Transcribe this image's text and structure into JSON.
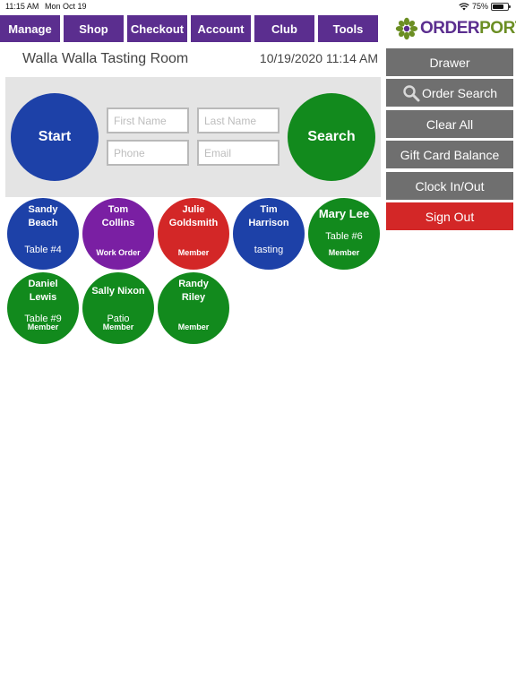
{
  "status_bar": {
    "time": "11:15 AM",
    "date": "Mon Oct 19",
    "battery": "75%",
    "battery_level": 0.75
  },
  "nav": {
    "items": [
      "Manage",
      "Shop",
      "Checkout",
      "Account",
      "Club",
      "Tools"
    ]
  },
  "logo": {
    "text_part1": "ORDER",
    "text_part2": "PORT",
    "icon": "flower-logo-icon",
    "color_1": "#5b2e8f",
    "color_2": "#6b8e23"
  },
  "header": {
    "room": "Walla Walla Tasting Room",
    "datetime": "10/19/2020 11:14 AM"
  },
  "search_panel": {
    "start_label": "Start",
    "search_label": "Search",
    "first_name_placeholder": "First Name",
    "last_name_placeholder": "Last Name",
    "phone_placeholder": "Phone",
    "email_placeholder": "Email"
  },
  "sidebar": {
    "drawer": "Drawer",
    "order_search": "Order Search",
    "clear_all": "Clear All",
    "gift_card_balance": "Gift Card Balance",
    "clock_in_out": "Clock In/Out",
    "sign_out": "Sign Out"
  },
  "orders": [
    {
      "name": "Sandy\nBeach",
      "sub": "Table #4",
      "tag": "",
      "color": "#1d41a8"
    },
    {
      "name": "Tom\nCollins",
      "sub": "",
      "tag": "Work Order",
      "color": "#7a1fa3"
    },
    {
      "name": "Julie\nGoldsmith",
      "sub": "",
      "tag": "Member",
      "color": "#d32727"
    },
    {
      "name": "Tim\nHarrison",
      "sub": "tasting",
      "tag": "",
      "color": "#1d41a8"
    },
    {
      "name": "Mary Lee",
      "sub": "Table #6",
      "tag": "Member",
      "color": "#128a1d"
    },
    {
      "name": "Daniel\nLewis",
      "sub": "Table #9",
      "tag": "Member",
      "color": "#128a1d"
    },
    {
      "name": "Sally Nixon",
      "sub": "Patio",
      "tag": "Member",
      "color": "#128a1d"
    },
    {
      "name": "Randy\nRiley",
      "sub": "",
      "tag": "Member",
      "color": "#128a1d"
    }
  ],
  "colors": {
    "nav": "#5b2e8f",
    "sidebar_button": "#6f6f6f",
    "sign_out": "#d32727",
    "start": "#1d41a8",
    "search": "#128a1d",
    "panel": "#e4e4e4"
  }
}
